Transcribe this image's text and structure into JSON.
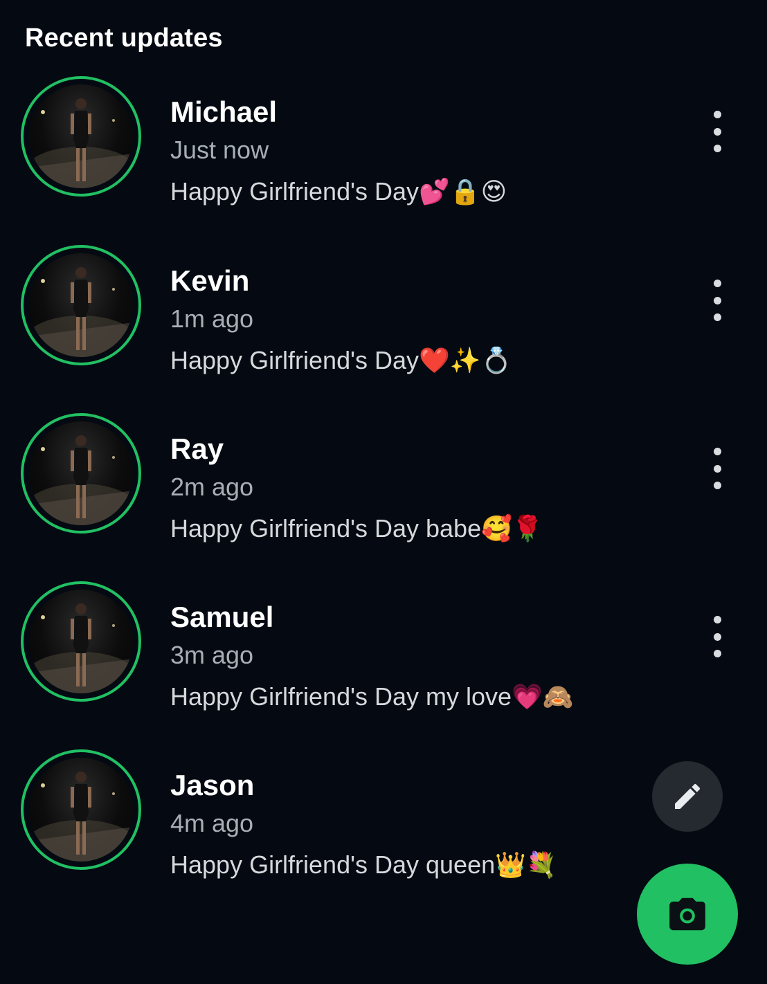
{
  "section": {
    "title": "Recent updates"
  },
  "colors": {
    "background": "#050a12",
    "ring": "#21c063",
    "camera_fab": "#21c063",
    "edit_fab": "#242a30"
  },
  "updates": [
    {
      "name": "Michael",
      "time": "Just now",
      "caption": "Happy Girlfriend's Day💕🔒😍",
      "menu_icon": "more-vertical-icon"
    },
    {
      "name": "Kevin",
      "time": "1m ago",
      "caption": "Happy Girlfriend's Day❤️✨💍",
      "menu_icon": "more-vertical-icon"
    },
    {
      "name": "Ray",
      "time": "2m ago",
      "caption": "Happy Girlfriend's Day babe🥰🌹",
      "menu_icon": "more-vertical-icon"
    },
    {
      "name": "Samuel",
      "time": "3m ago",
      "caption": "Happy Girlfriend's Day my love💗🙈",
      "menu_icon": "more-vertical-icon"
    },
    {
      "name": "Jason",
      "time": "4m ago",
      "caption": "Happy Girlfriend's Day queen👑💐",
      "menu_icon": "more-vertical-icon"
    }
  ],
  "fabs": {
    "edit_icon": "pencil-icon",
    "camera_icon": "camera-icon"
  }
}
